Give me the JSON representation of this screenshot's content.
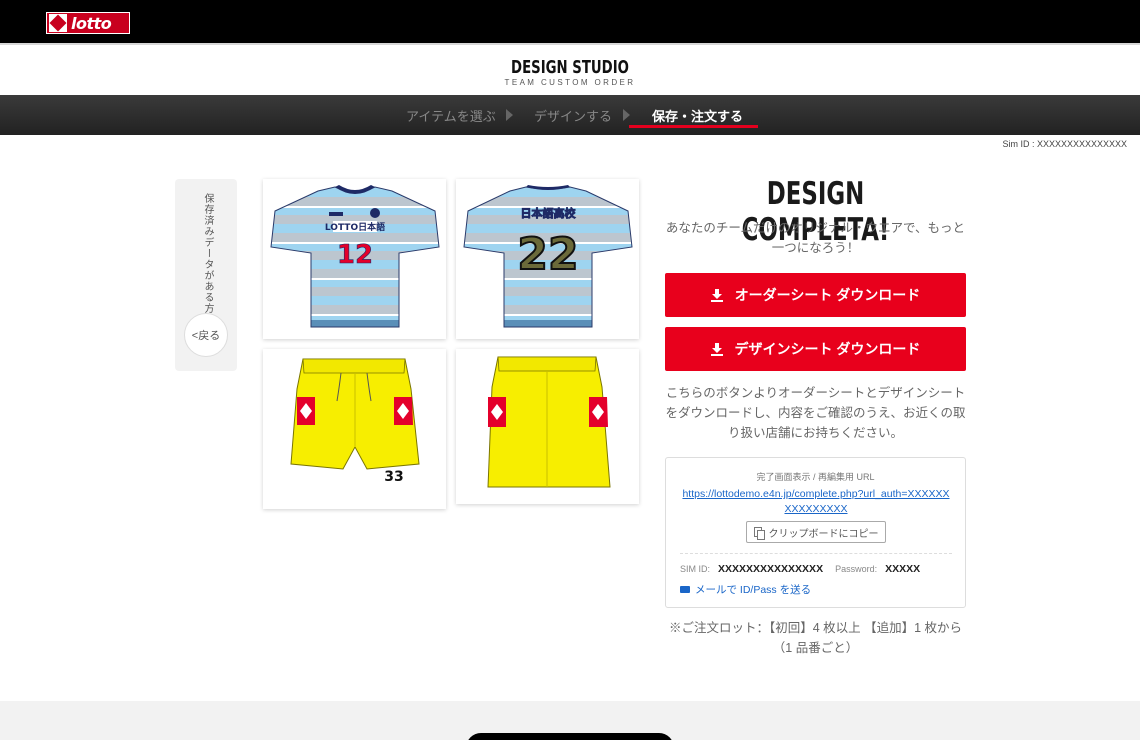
{
  "header": {
    "logo_text": "lotto",
    "logo_color": "#c8001e"
  },
  "brand": {
    "title": "DESIGN STUDIO",
    "subtitle": "TEAM CUSTOM ORDER"
  },
  "steps": [
    {
      "label": "アイテムを選ぶ",
      "active": false
    },
    {
      "label": "デザインする",
      "active": false
    },
    {
      "label": "保存・注文する",
      "active": true
    }
  ],
  "sim_id_line": "Sim ID : XXXXXXXXXXXXXXX",
  "side": {
    "tab_label": "保存済みデータがある方",
    "back_label": "<戻る"
  },
  "uniform": {
    "front_text": "LOTTO日本語",
    "front_number": "12",
    "back_text": "日本語高校",
    "back_number": "22",
    "shorts_number": "33",
    "shirt_stripe_light": "#9ed4f0",
    "shirt_stripe_grey": "#bcc6cf",
    "shorts_color": "#f7ee00"
  },
  "main": {
    "heading": "DESIGN COMPLETA!",
    "lead": "あなたのチームだけのオリジナル・ウエアで、もっと一つになろう！",
    "order_sheet_button": "オーダーシート ダウンロード",
    "design_sheet_button": "デザインシート ダウンロード",
    "info": "こちらのボタンよりオーダーシートとデザインシートをダウンロードし、内容をご確認のうえ、お近くの取り扱い店舗にお持ちください。",
    "accent_color": "#e8001c"
  },
  "urlbox": {
    "label": "完了画面表示 / 再編集用 URL",
    "url": "https://lottodemo.e4n.jp/complete.php?url_auth=XXXXXXXXXXXXXXX",
    "copy_button": "クリップボードにコピー",
    "sim_id_label": "SIM ID:",
    "sim_id_value": "XXXXXXXXXXXXXXX",
    "password_label": "Password:",
    "password_value": "XXXXX",
    "mail_link": "メールで ID/Pass を送る"
  },
  "note": "※ご注文ロット：【初回】4 枚以上 【追加】1 枚から（1 品番ごと）"
}
